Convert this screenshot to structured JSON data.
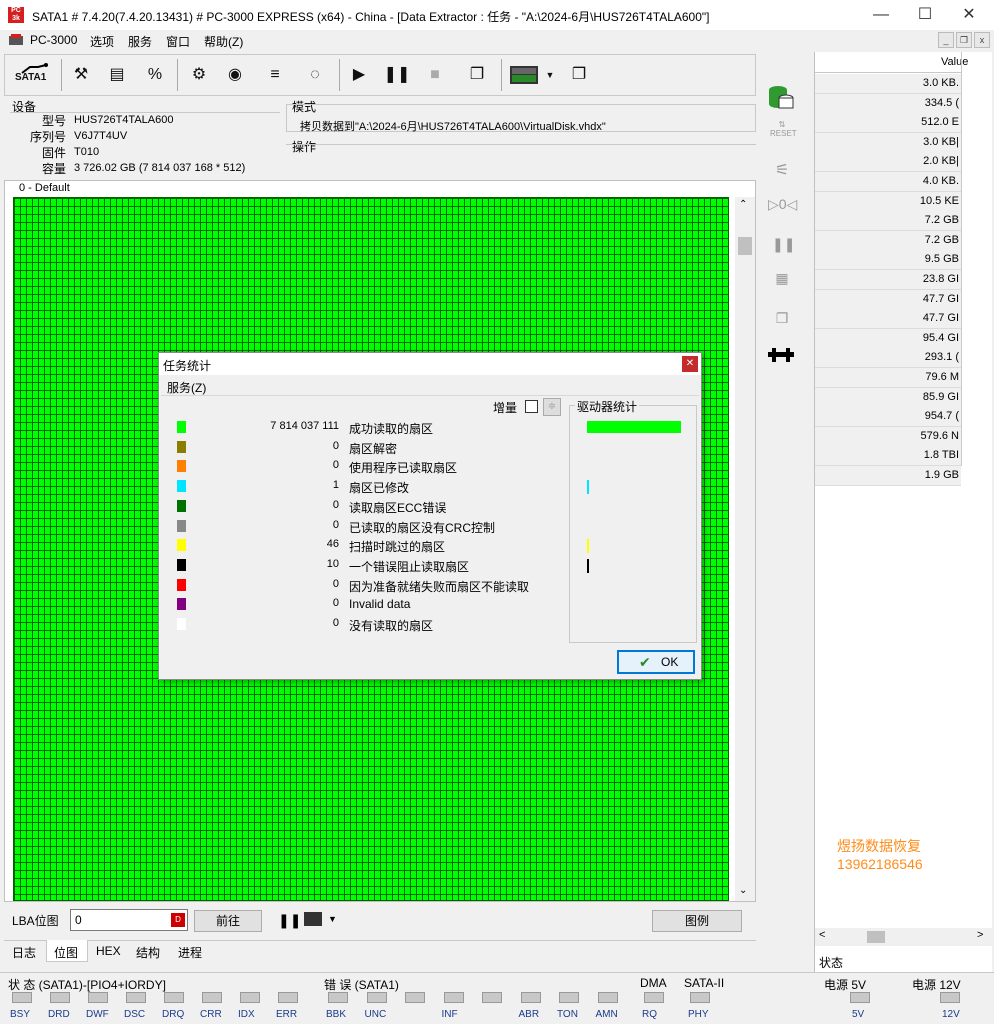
{
  "window": {
    "title": "SATA1 # 7.4.20(7.4.20.13431) # PC-3000 EXPRESS (x64) - China - [Data Extractor : 任务 - \"A:\\2024-6月\\HUS726T4TALA600\"]",
    "icon_text": "PC\n3000"
  },
  "menu": {
    "app_name": "PC-3000",
    "items": [
      "选项",
      "服务",
      "窗口",
      "帮助(Z)"
    ]
  },
  "toolbar": {
    "sata_label": "SATA1"
  },
  "device": {
    "section_title": "设备",
    "model_label": "型号",
    "model_value": "HUS726T4TALA600",
    "serial_label": "序列号",
    "serial_value": "V6J7T4UV",
    "firmware_label": "固件",
    "firmware_value": "T010",
    "capacity_label": "容量",
    "capacity_value": "3 726.02 GB (7 814 037 168 * 512)"
  },
  "mode": {
    "section_title": "模式",
    "value": "拷贝数据到\"A:\\2024-6月\\HUS726T4TALA600\\VirtualDisk.vhdx\"",
    "operation_title": "操作"
  },
  "map": {
    "group_label": "0 - Default"
  },
  "lba": {
    "label": "LBA位图",
    "value": "0",
    "goto_label": "前往",
    "legend_label": "图例"
  },
  "tabs": [
    "日志",
    "位图",
    "HEX",
    "结构",
    "进程"
  ],
  "dialog": {
    "title": "任务统计",
    "menu_label": "服务(Z)",
    "increment_label": "增量",
    "drive_stats_label": "驱动器统计",
    "ok_label": "OK",
    "rows": [
      {
        "color": "#00ff00",
        "count": "7 814 037 111",
        "label": "成功读取的扇区",
        "bar": 1.0
      },
      {
        "color": "#8b7d00",
        "count": "0",
        "label": "扇区解密",
        "bar": 0
      },
      {
        "color": "#ff8000",
        "count": "0",
        "label": "使用程序已读取扇区",
        "bar": 0
      },
      {
        "color": "#00e5ff",
        "count": "1",
        "label": "扇区已修改",
        "bar": 0.02
      },
      {
        "color": "#007000",
        "count": "0",
        "label": "读取扇区ECC错误",
        "bar": 0
      },
      {
        "color": "#888888",
        "count": "0",
        "label": "已读取的扇区没有CRC控制",
        "bar": 0
      },
      {
        "color": "#ffff00",
        "count": "46",
        "label": "扫描时跳过的扇区",
        "bar": 0.02
      },
      {
        "color": "#000000",
        "count": "10",
        "label": "一个错误阻止读取扇区",
        "bar": 0.02
      },
      {
        "color": "#ff0000",
        "count": "0",
        "label": "因为准备就绪失败而扇区不能读取",
        "bar": 0
      },
      {
        "color": "#800080",
        "count": "0",
        "label": "Invalid data",
        "bar": 0
      },
      {
        "color": "#ffffff",
        "count": "0",
        "label": "没有读取的扇区",
        "bar": 0
      }
    ]
  },
  "right_panel": {
    "header": "Value",
    "values": [
      "3.0 KB.",
      "334.5 (",
      "512.0 E",
      "3.0 KB|",
      "2.0 KB|",
      "4.0 KB.",
      "10.5 KE",
      "7.2 GB",
      "7.2 GB",
      "9.5 GB",
      "23.8 GI",
      "47.7 GI",
      "47.7 GI",
      "95.4 GI",
      "293.1 (",
      "79.6 M",
      "85.9 GI",
      "954.7 (",
      "579.6 N",
      "1.8 TBI",
      "1.9 GB"
    ],
    "watermark_line1": "煜扬数据恢复",
    "watermark_line2": "13962186546",
    "status_tab": "状态",
    "watermark_color": "#ff8c1a"
  },
  "status_strip": {
    "status_label": "状 态 (SATA1)-[PIO4+IORDY]",
    "status_leds": [
      "BSY",
      "DRD",
      "DWF",
      "DSC",
      "DRQ",
      "CRR",
      "IDX",
      "ERR"
    ],
    "error_label": "错 误 (SATA1)",
    "error_leds": [
      "BBK",
      "UNC",
      "",
      "INF",
      "",
      "ABR",
      "TON",
      "AMN"
    ],
    "dma_label": "DMA",
    "dma_leds": [
      "RQ"
    ],
    "sata_label": "SATA-II",
    "sata_leds": [
      "PHY"
    ],
    "power5_label": "电源 5V",
    "power5_led": "5V",
    "power12_label": "电源 12V",
    "power12_led": "12V"
  }
}
